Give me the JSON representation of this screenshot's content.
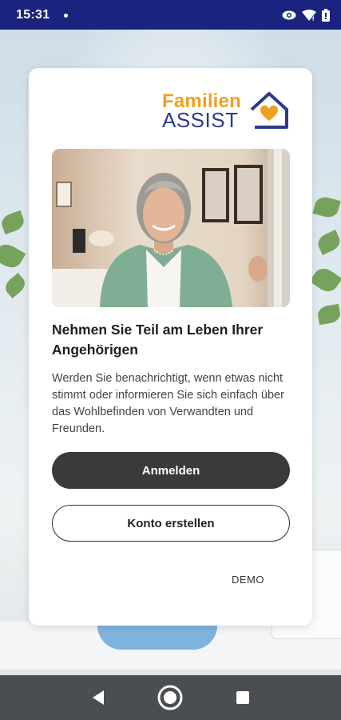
{
  "status_bar": {
    "time": "15:31"
  },
  "card": {
    "logo": {
      "line1": "Familien",
      "line2": "ASSIST"
    },
    "headline": "Nehmen Sie Teil am Leben Ihrer Angehörigen",
    "body": "Werden Sie benachrichtigt, wenn etwas nicht stimmt oder informieren Sie sich einfach über das Wohlbefinden von Verwandten und Freunden.",
    "login_label": "Anmelden",
    "register_label": "Konto erstellen",
    "demo_label": "DEMO"
  },
  "colors": {
    "status_bar": "#1a237e",
    "logo_orange": "#f0a020",
    "logo_blue": "#2b3a8c",
    "primary_button": "#3a3a3a",
    "nav_bar": "#4a4e52"
  },
  "icons": {
    "status": [
      "eye-icon",
      "wifi-icon",
      "battery-icon"
    ],
    "nav": [
      "back-icon",
      "home-icon",
      "recents-icon"
    ]
  }
}
